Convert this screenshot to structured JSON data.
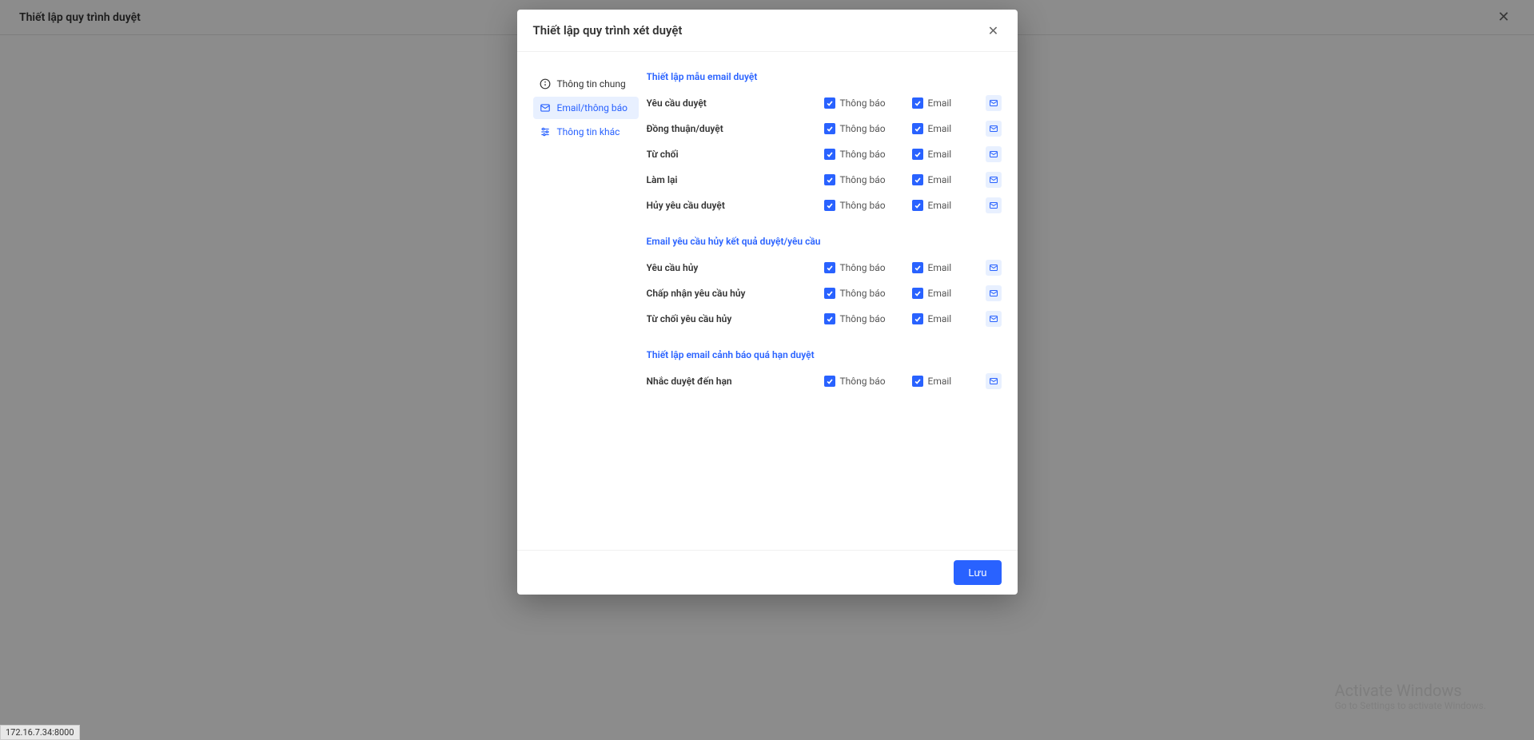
{
  "page": {
    "title": "Thiết lập quy trình duyệt"
  },
  "modal": {
    "title": "Thiết lập quy trình xét duyệt",
    "save_label": "Lưu"
  },
  "sidebar": {
    "items": [
      {
        "label": "Thông tin chung"
      },
      {
        "label": "Email/thông báo"
      },
      {
        "label": "Thông tin khác"
      }
    ]
  },
  "labels": {
    "notify": "Thông báo",
    "email": "Email"
  },
  "sections": [
    {
      "title": "Thiết lập mẫu email duyệt",
      "rows": [
        {
          "label": "Yêu cầu duyệt"
        },
        {
          "label": "Đồng thuận/duyệt"
        },
        {
          "label": "Từ chối"
        },
        {
          "label": "Làm lại"
        },
        {
          "label": "Hủy yêu cầu duyệt"
        }
      ]
    },
    {
      "title": "Email yêu cầu hủy kết quả duyệt/yêu cầu",
      "rows": [
        {
          "label": "Yêu cầu hủy"
        },
        {
          "label": "Chấp nhận yêu cầu hủy"
        },
        {
          "label": "Từ chối yêu cầu hủy"
        }
      ]
    },
    {
      "title": "Thiết lập email cảnh báo quá hạn duyệt",
      "rows": [
        {
          "label": "Nhắc duyệt đến hạn"
        }
      ]
    }
  ],
  "status_bar": "172.16.7.34:8000",
  "watermark": {
    "title": "Activate Windows",
    "sub": "Go to Settings to activate Windows."
  }
}
